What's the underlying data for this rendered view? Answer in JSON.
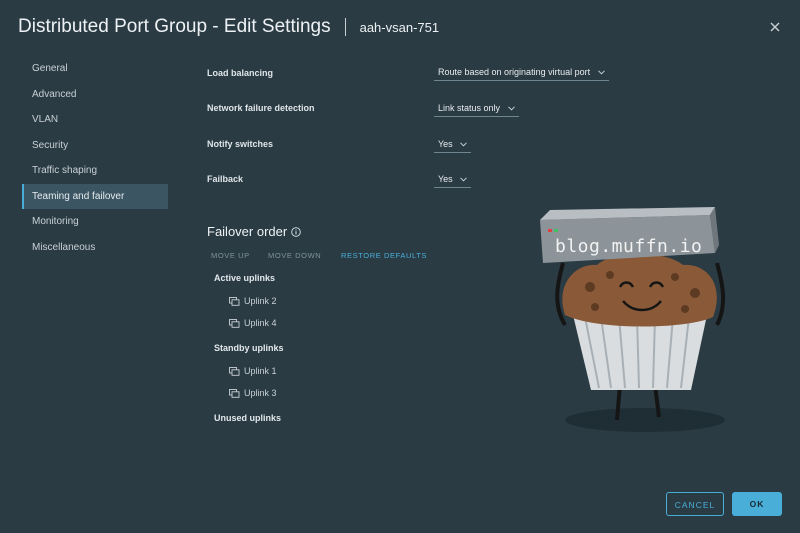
{
  "dialog": {
    "title": "Distributed Port Group - Edit Settings",
    "subtitle": "aah-vsan-751"
  },
  "nav": {
    "items": [
      {
        "label": "General"
      },
      {
        "label": "Advanced"
      },
      {
        "label": "VLAN"
      },
      {
        "label": "Security"
      },
      {
        "label": "Traffic shaping"
      },
      {
        "label": "Teaming and failover"
      },
      {
        "label": "Monitoring"
      },
      {
        "label": "Miscellaneous"
      }
    ],
    "active": "Teaming and failover"
  },
  "settings": {
    "load_balancing": {
      "label": "Load balancing",
      "value": "Route based on originating virtual port"
    },
    "network_failure": {
      "label": "Network failure detection",
      "value": "Link status only"
    },
    "notify_switches": {
      "label": "Notify switches",
      "value": "Yes"
    },
    "failback": {
      "label": "Failback",
      "value": "Yes"
    }
  },
  "failover": {
    "title": "Failover order",
    "move_up": "MOVE UP",
    "move_down": "MOVE DOWN",
    "restore_defaults": "RESTORE DEFAULTS",
    "active_label": "Active uplinks",
    "active": [
      "Uplink 2",
      "Uplink 4"
    ],
    "standby_label": "Standby uplinks",
    "standby": [
      "Uplink 1",
      "Uplink 3"
    ],
    "unused_label": "Unused uplinks"
  },
  "watermark": "blog.muffn.io",
  "footer": {
    "cancel": "CANCEL",
    "ok": "OK"
  },
  "colors": {
    "accent": "#49afd9",
    "background": "#2a3b44",
    "nav_active": "#3c5563"
  },
  "icons": {
    "close": "close-icon",
    "chevron": "chevron-down-icon",
    "info": "info-icon",
    "uplink": "uplink-icon"
  }
}
